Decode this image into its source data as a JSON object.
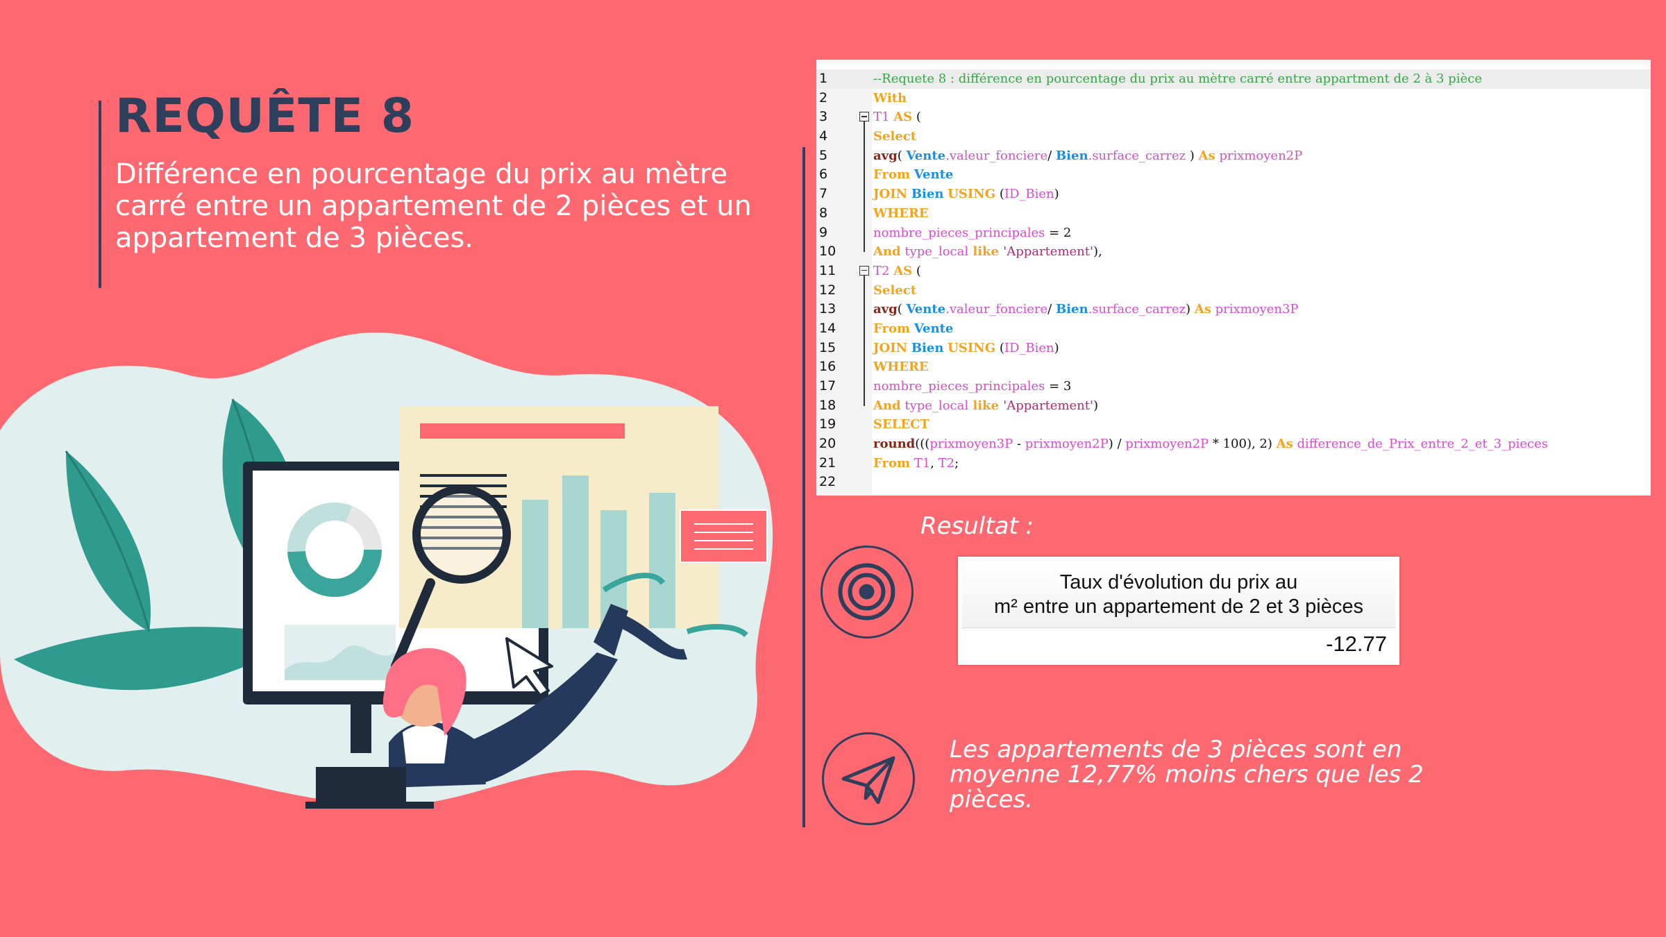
{
  "slide": {
    "title": "REQUÊTE 8",
    "subtitle": "Différence en pourcentage du prix au mètre carré entre un   appartement de 2 pièces et un appartement de 3 pièces."
  },
  "code": {
    "lines": [
      {
        "n": "1",
        "segs": [
          [
            "c-comment",
            "--Requete 8 : différence en pourcentage du prix au mètre carré entre appartment de 2 à 3 pièce"
          ]
        ]
      },
      {
        "n": "2",
        "segs": [
          [
            "c-kw",
            "With"
          ]
        ]
      },
      {
        "n": "3",
        "segs": [
          [
            "c-id",
            "T1"
          ],
          [
            "c-plain",
            " "
          ],
          [
            "c-kw",
            "AS"
          ],
          [
            "c-plain",
            " ("
          ]
        ]
      },
      {
        "n": "4",
        "segs": [
          [
            "c-kw",
            "Select"
          ]
        ]
      },
      {
        "n": "5",
        "segs": [
          [
            "c-plain",
            " "
          ],
          [
            "c-fn",
            "avg"
          ],
          [
            "c-plain",
            "( "
          ],
          [
            "c-tbl",
            "Vente"
          ],
          [
            "c-id",
            ".valeur_fonciere"
          ],
          [
            "c-plain",
            "/ "
          ],
          [
            "c-tbl",
            "Bien"
          ],
          [
            "c-id",
            ".surface_carrez"
          ],
          [
            "c-plain",
            " ) "
          ],
          [
            "c-kw",
            "As"
          ],
          [
            "c-id",
            " prixmoyen2P"
          ]
        ]
      },
      {
        "n": "6",
        "segs": [
          [
            "c-plain",
            " "
          ],
          [
            "c-kw",
            "From"
          ],
          [
            "c-plain",
            " "
          ],
          [
            "c-tbl",
            "Vente"
          ]
        ]
      },
      {
        "n": "7",
        "segs": [
          [
            "c-plain",
            "  "
          ],
          [
            "c-kw",
            "JOIN"
          ],
          [
            "c-plain",
            " "
          ],
          [
            "c-tbl",
            "Bien"
          ],
          [
            "c-plain",
            " "
          ],
          [
            "c-kw",
            "USING"
          ],
          [
            "c-plain",
            " ("
          ],
          [
            "c-id",
            "ID_Bien"
          ],
          [
            "c-plain",
            ")"
          ]
        ]
      },
      {
        "n": "8",
        "segs": [
          [
            "c-plain",
            "  "
          ],
          [
            "c-kw",
            "WHERE"
          ]
        ]
      },
      {
        "n": "9",
        "segs": [
          [
            "c-id",
            "nombre_pieces_principales"
          ],
          [
            "c-plain",
            " = 2"
          ]
        ]
      },
      {
        "n": "10",
        "segs": [
          [
            "c-kw",
            "And"
          ],
          [
            "c-id",
            " type_local"
          ],
          [
            "c-kw",
            " like "
          ],
          [
            "c-str",
            "'Appartement'"
          ],
          [
            "c-plain",
            "),"
          ]
        ]
      },
      {
        "n": "11",
        "segs": [
          [
            "c-plain",
            " "
          ],
          [
            "c-id",
            "T2"
          ],
          [
            "c-plain",
            " "
          ],
          [
            "c-kw",
            "AS"
          ],
          [
            "c-plain",
            " ("
          ]
        ]
      },
      {
        "n": "12",
        "segs": [
          [
            "c-kw",
            "Select"
          ]
        ]
      },
      {
        "n": "13",
        "segs": [
          [
            "c-plain",
            " "
          ],
          [
            "c-fn",
            "avg"
          ],
          [
            "c-plain",
            "( "
          ],
          [
            "c-tbl",
            "Vente"
          ],
          [
            "c-id",
            ".valeur_fonciere"
          ],
          [
            "c-plain",
            "/ "
          ],
          [
            "c-tbl",
            "Bien"
          ],
          [
            "c-id",
            ".surface_carrez"
          ],
          [
            "c-plain",
            ") "
          ],
          [
            "c-kw",
            "As"
          ],
          [
            "c-id",
            " prixmoyen3P"
          ]
        ]
      },
      {
        "n": "14",
        "segs": [
          [
            "c-plain",
            " "
          ],
          [
            "c-kw",
            "From"
          ],
          [
            "c-plain",
            " "
          ],
          [
            "c-tbl",
            "Vente"
          ]
        ]
      },
      {
        "n": "15",
        "segs": [
          [
            "c-plain",
            " "
          ],
          [
            "c-kw",
            "JOIN"
          ],
          [
            "c-plain",
            " "
          ],
          [
            "c-tbl",
            "Bien"
          ],
          [
            "c-plain",
            " "
          ],
          [
            "c-kw",
            "USING"
          ],
          [
            "c-plain",
            " ("
          ],
          [
            "c-id",
            "ID_Bien"
          ],
          [
            "c-plain",
            ")"
          ]
        ]
      },
      {
        "n": "16",
        "segs": [
          [
            "c-kw",
            "WHERE"
          ]
        ]
      },
      {
        "n": "17",
        "segs": [
          [
            "c-id",
            "nombre_pieces_principales"
          ],
          [
            "c-plain",
            " = 3"
          ]
        ]
      },
      {
        "n": "18",
        "segs": [
          [
            "c-kw",
            "And"
          ],
          [
            "c-id",
            " type_local"
          ],
          [
            "c-kw",
            " like "
          ],
          [
            "c-str",
            "'Appartement'"
          ],
          [
            "c-plain",
            ")"
          ]
        ]
      },
      {
        "n": "19",
        "segs": [
          [
            "c-kw",
            "SELECT"
          ]
        ]
      },
      {
        "n": "20",
        "segs": [
          [
            "c-plain",
            "  "
          ],
          [
            "c-fn",
            "round"
          ],
          [
            "c-plain",
            "((("
          ],
          [
            "c-id",
            "prixmoyen3P"
          ],
          [
            "c-plain",
            " - "
          ],
          [
            "c-id",
            "prixmoyen2P"
          ],
          [
            "c-plain",
            ") / "
          ],
          [
            "c-id",
            "prixmoyen2P"
          ],
          [
            "c-plain",
            " * 100), 2) "
          ],
          [
            "c-kw",
            "As"
          ],
          [
            "c-id",
            " difference_de_Prix_entre_2_et_3_pieces"
          ]
        ]
      },
      {
        "n": "21",
        "segs": [
          [
            "c-plain",
            "  "
          ],
          [
            "c-kw",
            "From"
          ],
          [
            "c-id",
            " T1"
          ],
          [
            "c-plain",
            ", "
          ],
          [
            "c-id",
            "T2"
          ],
          [
            "c-plain",
            ";"
          ]
        ]
      },
      {
        "n": "22",
        "segs": []
      }
    ]
  },
  "result": {
    "label": "Resultat :",
    "header_line1": "Taux d'évolution du prix au",
    "header_line2": "m² entre un appartement de 2 et 3 pièces",
    "value": "-12.77"
  },
  "conclusion": "Les appartements de 3 pièces sont en moyenne 12,77% moins chers que les 2 pièces.",
  "icons": {
    "result": "target-icon",
    "conclusion": "paper-plane-icon"
  },
  "colors": {
    "background": "#fe6870",
    "navy": "#2e3f5c",
    "teal": "#3aa59b",
    "cream": "#f7ecc9"
  }
}
